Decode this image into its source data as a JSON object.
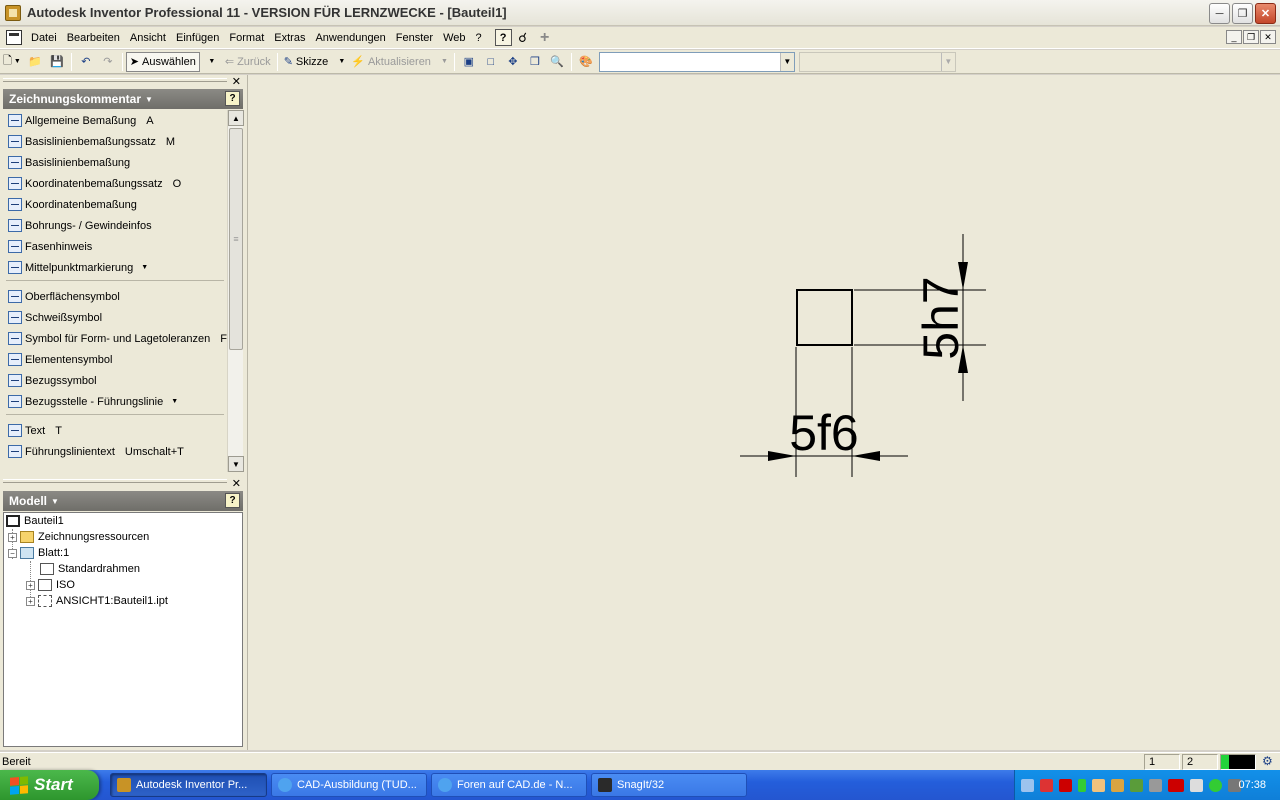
{
  "window": {
    "title": "Autodesk Inventor Professional 11 - VERSION FÜR LERNZWECKE - [Bauteil1]"
  },
  "menubar": {
    "items": [
      {
        "label": "Datei",
        "u": "D"
      },
      {
        "label": "Bearbeiten",
        "u": "B"
      },
      {
        "label": "Ansicht",
        "u": "A"
      },
      {
        "label": "Einfügen",
        "u": "E"
      },
      {
        "label": "Format",
        "u": "o"
      },
      {
        "label": "Extras",
        "u": "x"
      },
      {
        "label": "Anwendungen",
        "u": "n"
      },
      {
        "label": "Fenster",
        "u": "F"
      },
      {
        "label": "Web",
        "u": "W"
      },
      {
        "label": "?",
        "u": "?"
      }
    ]
  },
  "toolbar": {
    "select_label": "Auswählen",
    "back_label": "Zurück",
    "sketch_label": "Skizze",
    "update_label": "Aktualisieren",
    "style_combo_value": "",
    "layer_combo_value": ""
  },
  "annotation_panel": {
    "title": "Zeichnungskommentar",
    "commands": [
      {
        "label": "Allgemeine Bemaßung",
        "key": "A"
      },
      {
        "label": "Basislinienbemaßungssatz",
        "key": "M"
      },
      {
        "label": "Basislinienbemaßung",
        "key": ""
      },
      {
        "label": "Koordinatenbemaßungssatz",
        "key": "O"
      },
      {
        "label": "Koordinatenbemaßung",
        "key": ""
      },
      {
        "label": "Bohrungs- / Gewindeinfos",
        "key": ""
      },
      {
        "label": "Fasenhinweis",
        "key": ""
      },
      {
        "label": "Mittelpunktmarkierung",
        "key": ""
      },
      {
        "label": "Oberflächensymbol",
        "key": ""
      },
      {
        "label": "Schweißsymbol",
        "key": ""
      },
      {
        "label": "Symbol für Form- und Lagetoleranzen",
        "key": "F"
      },
      {
        "label": "Elementensymbol",
        "key": ""
      },
      {
        "label": "Bezugssymbol",
        "key": ""
      },
      {
        "label": "Bezugsstelle - Führungslinie",
        "key": ""
      },
      {
        "label": "Text",
        "key": "T"
      },
      {
        "label": "Führungslinientext",
        "key": "Umschalt+T"
      }
    ]
  },
  "model_panel": {
    "title": "Modell",
    "tree": [
      {
        "label": "Bauteil1"
      },
      {
        "label": "Zeichnungsressourcen"
      },
      {
        "label": "Blatt:1"
      },
      {
        "label": "Standardrahmen"
      },
      {
        "label": "ISO"
      },
      {
        "label": "ANSICHT1:Bauteil1.ipt"
      }
    ]
  },
  "drawing": {
    "horizontal_dimension": "5f6",
    "vertical_dimension": "5h7"
  },
  "statusbar": {
    "text": "Bereit",
    "cell1": "1",
    "cell2": "2"
  },
  "taskbar": {
    "start_label": "Start",
    "tasks": [
      {
        "label": "Autodesk Inventor Pr...",
        "active": true
      },
      {
        "label": "CAD-Ausbildung (TUD...",
        "active": false
      },
      {
        "label": "Foren auf CAD.de - N...",
        "active": false
      },
      {
        "label": "SnagIt/32",
        "active": false
      }
    ],
    "clock": "07:38"
  }
}
